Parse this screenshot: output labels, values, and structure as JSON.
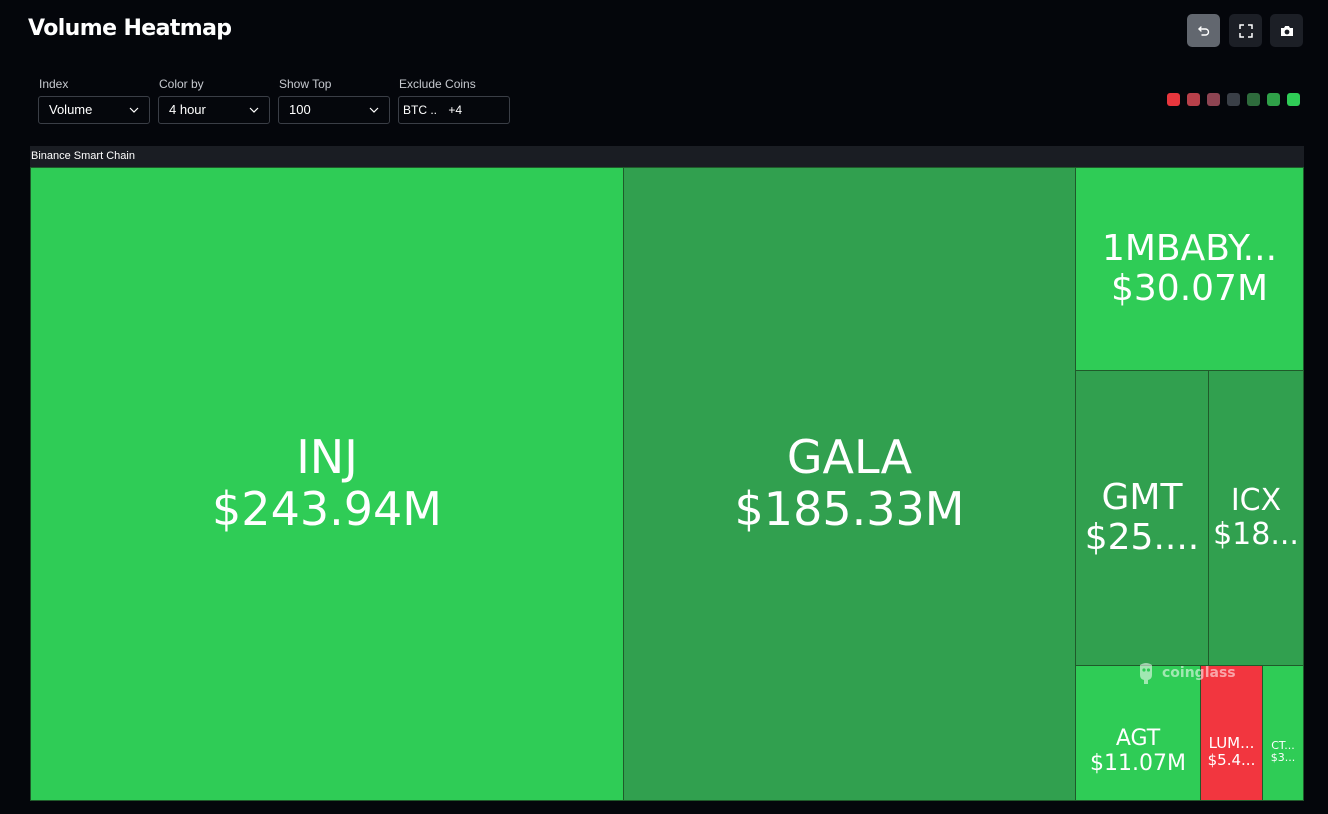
{
  "header": {
    "title": "Volume Heatmap"
  },
  "toolbar": {
    "buttons": [
      {
        "name": "reset-button",
        "icon": "undo-icon",
        "active": true
      },
      {
        "name": "fullscreen-button",
        "icon": "fullscreen-icon",
        "active": false
      },
      {
        "name": "screenshot-button",
        "icon": "camera-icon",
        "active": false
      }
    ]
  },
  "filters": {
    "index": {
      "label": "Index",
      "value": "Volume"
    },
    "color_by": {
      "label": "Color by",
      "value": "4 hour"
    },
    "show_top": {
      "label": "Show Top",
      "value": "100"
    },
    "exclude": {
      "label": "Exclude Coins",
      "tag": "BTC ..",
      "more": "+4"
    }
  },
  "legend": {
    "colors": [
      "#e8363d",
      "#b8404a",
      "#8e4452",
      "#3a3f47",
      "#2e6b3c",
      "#2fa048",
      "#2fcc56"
    ]
  },
  "group": {
    "label": "Binance Smart Chain"
  },
  "watermark": {
    "text": "coinglass"
  },
  "tiles": [
    {
      "name": "tile-inj",
      "symbol": "INJ",
      "value": "$243.94M",
      "color": "#2fcc56"
    },
    {
      "name": "tile-gala",
      "symbol": "GALA",
      "value": "$185.33M",
      "color": "#31a04f"
    },
    {
      "name": "tile-1mbaby",
      "symbol": "1MBABY...",
      "value": "$30.07M",
      "color": "#2fcc56"
    },
    {
      "name": "tile-gmt",
      "symbol": "GMT",
      "value": "$25....",
      "color": "#31a04f"
    },
    {
      "name": "tile-icx",
      "symbol": "ICX",
      "value": "$18...",
      "color": "#31a04f"
    },
    {
      "name": "tile-agt",
      "symbol": "AGT",
      "value": "$11.07M",
      "color": "#2fcc56"
    },
    {
      "name": "tile-lum",
      "symbol": "LUM...",
      "value": "$5.4...",
      "color": "#f2363f"
    },
    {
      "name": "tile-ct",
      "symbol": "CT...",
      "value": "$3...",
      "color": "#2fcc56"
    }
  ]
}
